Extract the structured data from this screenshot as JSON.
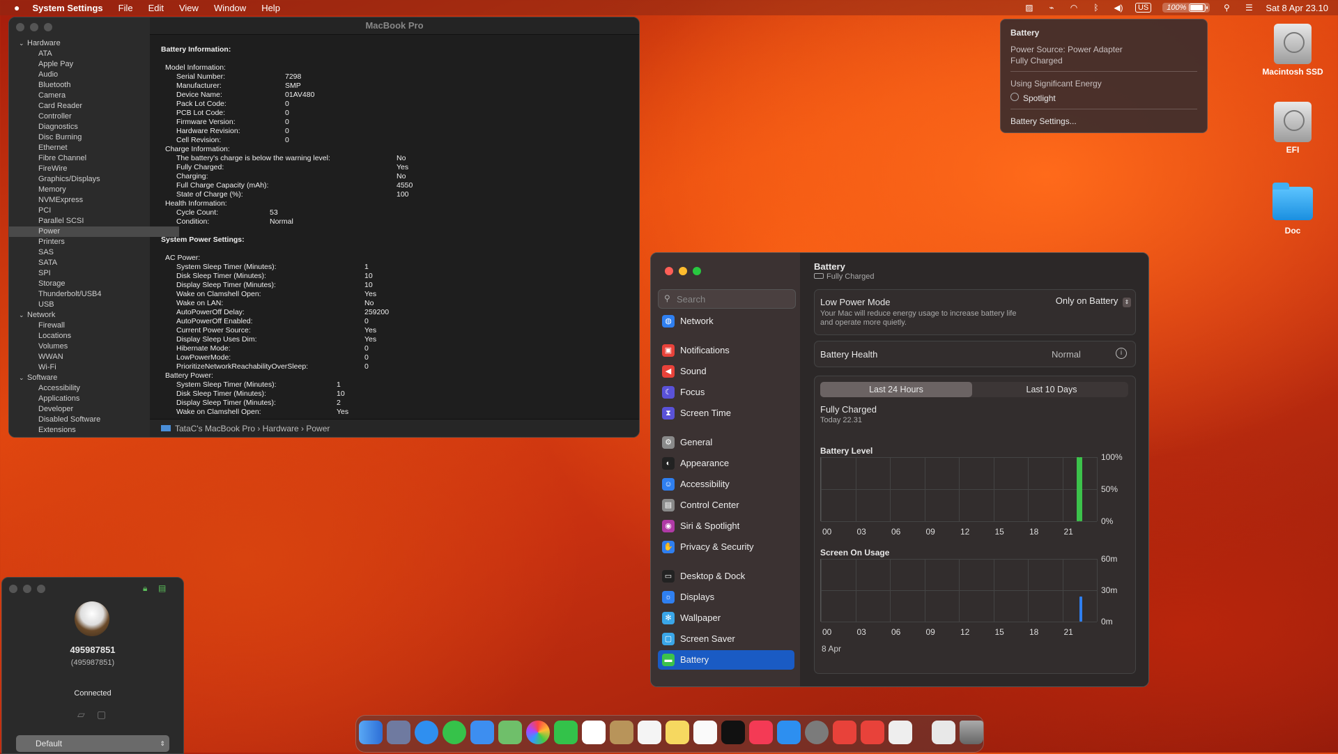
{
  "menubar": {
    "app": "System Settings",
    "menus": [
      "File",
      "Edit",
      "View",
      "Window",
      "Help"
    ],
    "input_source": "US",
    "battery_percent": "100%",
    "datetime": "Sat 8 Apr  23.10"
  },
  "battery_menu": {
    "title": "Battery",
    "power_source": "Power Source: Power Adapter",
    "status": "Fully Charged",
    "energy_heading": "Using Significant Energy",
    "energy_app": "Spotlight",
    "settings_link": "Battery Settings..."
  },
  "desktop_icons": [
    "Macintosh SSD",
    "EFI",
    "Doc"
  ],
  "sysinfo": {
    "title": "MacBook Pro",
    "sidebar": [
      {
        "label": "Hardware",
        "level": 0
      },
      {
        "label": "ATA",
        "level": 1
      },
      {
        "label": "Apple Pay",
        "level": 1
      },
      {
        "label": "Audio",
        "level": 1
      },
      {
        "label": "Bluetooth",
        "level": 1
      },
      {
        "label": "Camera",
        "level": 1
      },
      {
        "label": "Card Reader",
        "level": 1
      },
      {
        "label": "Controller",
        "level": 1
      },
      {
        "label": "Diagnostics",
        "level": 1
      },
      {
        "label": "Disc Burning",
        "level": 1
      },
      {
        "label": "Ethernet",
        "level": 1
      },
      {
        "label": "Fibre Channel",
        "level": 1
      },
      {
        "label": "FireWire",
        "level": 1
      },
      {
        "label": "Graphics/Displays",
        "level": 1
      },
      {
        "label": "Memory",
        "level": 1
      },
      {
        "label": "NVMExpress",
        "level": 1
      },
      {
        "label": "PCI",
        "level": 1
      },
      {
        "label": "Parallel SCSI",
        "level": 1
      },
      {
        "label": "Power",
        "level": 1,
        "selected": true
      },
      {
        "label": "Printers",
        "level": 1
      },
      {
        "label": "SAS",
        "level": 1
      },
      {
        "label": "SATA",
        "level": 1
      },
      {
        "label": "SPI",
        "level": 1
      },
      {
        "label": "Storage",
        "level": 1
      },
      {
        "label": "Thunderbolt/USB4",
        "level": 1
      },
      {
        "label": "USB",
        "level": 1
      },
      {
        "label": "Network",
        "level": 0
      },
      {
        "label": "Firewall",
        "level": 1
      },
      {
        "label": "Locations",
        "level": 1
      },
      {
        "label": "Volumes",
        "level": 1
      },
      {
        "label": "WWAN",
        "level": 1
      },
      {
        "label": "Wi-Fi",
        "level": 1
      },
      {
        "label": "Software",
        "level": 0
      },
      {
        "label": "Accessibility",
        "level": 1
      },
      {
        "label": "Applications",
        "level": 1
      },
      {
        "label": "Developer",
        "level": 1
      },
      {
        "label": "Disabled Software",
        "level": 1
      },
      {
        "label": "Extensions",
        "level": 1
      }
    ],
    "lines": [
      {
        "t": "Battery Information:",
        "i": 0,
        "b": true
      },
      {
        "t": "",
        "i": 0
      },
      {
        "t": "Model Information:",
        "i": 1
      },
      {
        "t": "Serial Number:",
        "v": "7298",
        "i": 2,
        "c": 1
      },
      {
        "t": "Manufacturer:",
        "v": "SMP",
        "i": 2,
        "c": 1
      },
      {
        "t": "Device Name:",
        "v": "01AV480",
        "i": 2,
        "c": 1
      },
      {
        "t": "Pack Lot Code:",
        "v": "0",
        "i": 2,
        "c": 1
      },
      {
        "t": "PCB Lot Code:",
        "v": "0",
        "i": 2,
        "c": 1
      },
      {
        "t": "Firmware Version:",
        "v": "0",
        "i": 2,
        "c": 1
      },
      {
        "t": "Hardware Revision:",
        "v": "0",
        "i": 2,
        "c": 1
      },
      {
        "t": "Cell Revision:",
        "v": "0",
        "i": 2,
        "c": 1
      },
      {
        "t": "Charge Information:",
        "i": 1
      },
      {
        "t": "The battery's charge is below the warning level:",
        "v": "No",
        "i": 2,
        "c": 2
      },
      {
        "t": "Fully Charged:",
        "v": "Yes",
        "i": 2,
        "c": 2
      },
      {
        "t": "Charging:",
        "v": "No",
        "i": 2,
        "c": 2
      },
      {
        "t": "Full Charge Capacity (mAh):",
        "v": "4550",
        "i": 2,
        "c": 2
      },
      {
        "t": "State of Charge (%):",
        "v": "100",
        "i": 2,
        "c": 2
      },
      {
        "t": "Health Information:",
        "i": 1
      },
      {
        "t": "Cycle Count:",
        "v": "53",
        "i": 2,
        "c": 3
      },
      {
        "t": "Condition:",
        "v": "Normal",
        "i": 2,
        "c": 3
      },
      {
        "t": "",
        "i": 0
      },
      {
        "t": "System Power Settings:",
        "i": 0,
        "b": true
      },
      {
        "t": "",
        "i": 0
      },
      {
        "t": "AC Power:",
        "i": 1
      },
      {
        "t": "System Sleep Timer (Minutes):",
        "v": "1",
        "i": 2,
        "c": 4
      },
      {
        "t": "Disk Sleep Timer (Minutes):",
        "v": "10",
        "i": 2,
        "c": 4
      },
      {
        "t": "Display Sleep Timer (Minutes):",
        "v": "10",
        "i": 2,
        "c": 4
      },
      {
        "t": "Wake on Clamshell Open:",
        "v": "Yes",
        "i": 2,
        "c": 4
      },
      {
        "t": "Wake on LAN:",
        "v": "No",
        "i": 2,
        "c": 4
      },
      {
        "t": "AutoPowerOff Delay:",
        "v": "259200",
        "i": 2,
        "c": 4
      },
      {
        "t": "AutoPowerOff Enabled:",
        "v": "0",
        "i": 2,
        "c": 4
      },
      {
        "t": "Current Power Source:",
        "v": "Yes",
        "i": 2,
        "c": 4
      },
      {
        "t": "Display Sleep Uses Dim:",
        "v": "Yes",
        "i": 2,
        "c": 4
      },
      {
        "t": "Hibernate Mode:",
        "v": "0",
        "i": 2,
        "c": 4
      },
      {
        "t": "LowPowerMode:",
        "v": "0",
        "i": 2,
        "c": 4
      },
      {
        "t": "PrioritizeNetworkReachabilityOverSleep:",
        "v": "0",
        "i": 2,
        "c": 4
      },
      {
        "t": "Battery Power:",
        "i": 1
      },
      {
        "t": "System Sleep Timer (Minutes):",
        "v": "1",
        "i": 2,
        "c": 5
      },
      {
        "t": "Disk Sleep Timer (Minutes):",
        "v": "10",
        "i": 2,
        "c": 5
      },
      {
        "t": "Display Sleep Timer (Minutes):",
        "v": "2",
        "i": 2,
        "c": 5
      },
      {
        "t": "Wake on Clamshell Open:",
        "v": "Yes",
        "i": 2,
        "c": 5
      }
    ],
    "path": "TataC's MacBook Pro  ›  Hardware  ›  Power"
  },
  "settings": {
    "search_placeholder": "Search",
    "sidebar": [
      {
        "label": "Network",
        "icon": "network-icon",
        "color": "#2f7ff0",
        "glyph": "◍"
      },
      {
        "label": "Notifications",
        "icon": "notifications-icon",
        "color": "#e8423a",
        "glyph": "▣"
      },
      {
        "label": "Sound",
        "icon": "sound-icon",
        "color": "#e8423a",
        "glyph": "◀"
      },
      {
        "label": "Focus",
        "icon": "focus-icon",
        "color": "#5a52d8",
        "glyph": "☾"
      },
      {
        "label": "Screen Time",
        "icon": "screen-time-icon",
        "color": "#5a52d8",
        "glyph": "⧗"
      },
      {
        "label": "General",
        "icon": "general-icon",
        "color": "#8a8a8a",
        "glyph": "⚙"
      },
      {
        "label": "Appearance",
        "icon": "appearance-icon",
        "color": "#222222",
        "glyph": "◐"
      },
      {
        "label": "Accessibility",
        "icon": "accessibility-icon",
        "color": "#2f7ff0",
        "glyph": "☺"
      },
      {
        "label": "Control Center",
        "icon": "control-center-icon",
        "color": "#8a8a8a",
        "glyph": "▤"
      },
      {
        "label": "Siri & Spotlight",
        "icon": "siri-icon",
        "color": "#b03aa6",
        "glyph": "◉"
      },
      {
        "label": "Privacy & Security",
        "icon": "privacy-icon",
        "color": "#2f7ff0",
        "glyph": "✋"
      },
      {
        "label": "Desktop & Dock",
        "icon": "desktop-dock-icon",
        "color": "#222222",
        "glyph": "▭"
      },
      {
        "label": "Displays",
        "icon": "displays-icon",
        "color": "#2f7ff0",
        "glyph": "☼"
      },
      {
        "label": "Wallpaper",
        "icon": "wallpaper-icon",
        "color": "#3aa6e8",
        "glyph": "✻"
      },
      {
        "label": "Screen Saver",
        "icon": "screen-saver-icon",
        "color": "#3aa6e8",
        "glyph": "▢"
      },
      {
        "label": "Battery",
        "icon": "battery-icon",
        "color": "#3cc24b",
        "glyph": "▬",
        "selected": true
      }
    ],
    "header_title": "Battery",
    "header_sub": "Fully Charged",
    "low_power_label": "Low Power Mode",
    "low_power_desc": "Your Mac will reduce energy usage to increase battery life and operate more quietly.",
    "low_power_value": "Only on Battery",
    "health_label": "Battery Health",
    "health_value": "Normal",
    "tabs": [
      "Last 24 Hours",
      "Last 10 Days"
    ],
    "status_title": "Fully Charged",
    "status_time": "Today 22.31",
    "date_label": "8 Apr"
  },
  "chart_data": [
    {
      "type": "bar",
      "title": "Battery Level",
      "x_ticks": [
        "00",
        "03",
        "06",
        "09",
        "12",
        "15",
        "18",
        "21"
      ],
      "y_ticks": [
        "100%",
        "50%",
        "0%"
      ],
      "ylim": [
        0,
        100
      ],
      "bars": [
        {
          "hour": 22.25,
          "value": 100
        },
        {
          "hour": 22.5,
          "value": 100
        }
      ],
      "color": "#3cc24b"
    },
    {
      "type": "bar",
      "title": "Screen On Usage",
      "x_ticks": [
        "00",
        "03",
        "06",
        "09",
        "12",
        "15",
        "18",
        "21"
      ],
      "y_ticks": [
        "60m",
        "30m",
        "0m"
      ],
      "ylim": [
        0,
        60
      ],
      "bars": [
        {
          "hour": 22.5,
          "value": 24
        }
      ],
      "color": "#2f7ff0"
    }
  ],
  "client": {
    "id": "495987851",
    "id_paren": "(495987851)",
    "status": "Connected",
    "profile": "Default"
  }
}
